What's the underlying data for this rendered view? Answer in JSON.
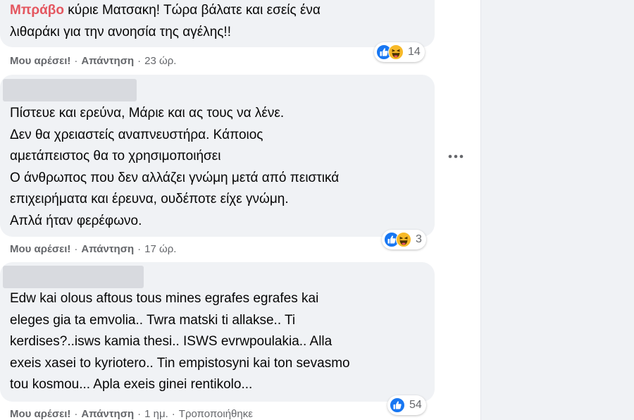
{
  "comments": [
    {
      "name_blurred": true,
      "lines": [
        "κύριε Ματσακη! Τώρα βάλατε και εσείς ένα",
        "λιθαράκι για την ανοησία της αγέλης!!"
      ],
      "highlight_word": "Μπράβο",
      "like_label": "Μου αρέσει!",
      "reply_label": "Απάντηση",
      "time": "23 ώρ.",
      "reaction_icons": [
        "like-icon",
        "haha-icon"
      ],
      "reaction_count": "14"
    },
    {
      "name_blurred": true,
      "lines": [
        "Πίστευε και ερεύνα, Μάριε και ας τους να λένε.",
        "Δεν θα χρειαστείς αναπνευστήρα. Κάποιος",
        "αμετάπειστος θα το χρησιμοποιήσει",
        "Ο άνθρωπος που δεν αλλάζει γνώμη μετά από πειστικά",
        "επιχειρήματα και έρευνα, ουδέποτε είχε γνώμη.",
        "Απλά ήταν φερέφωνο."
      ],
      "like_label": "Μου αρέσει!",
      "reply_label": "Απάντηση",
      "time": "17 ώρ.",
      "reaction_icons": [
        "like-icon",
        "haha-icon"
      ],
      "reaction_count": "3"
    },
    {
      "name_blurred": true,
      "lines": [
        "Edw kai olous aftous tous mines egrafes egrafes kai",
        "eleges gia ta emvolia.. Twra matski ti allakse.. Ti",
        "kerdises?..isws kamia thesi.. ISWS evrwpoulakia.. Alla",
        "exeis xasei to kyriotero.. Tin empistosyni kai ton sevasmo",
        "tou kosmou... Apla exeis ginei rentikolo..."
      ],
      "like_label": "Μου αρέσει!",
      "reply_label": "Απάντηση",
      "time": "1 ημ.",
      "edited_label": "Τροποποιήθηκε",
      "reaction_icons": [
        "like-icon"
      ],
      "reaction_count": "54"
    }
  ],
  "more_options_icon": "more-options-icon",
  "colors": {
    "accent": "#e4565f",
    "bubble": "#f0f2f5",
    "like_blue": "#1877f2",
    "haha_yellow": "#f7b928",
    "muted_text": "#65676b"
  }
}
